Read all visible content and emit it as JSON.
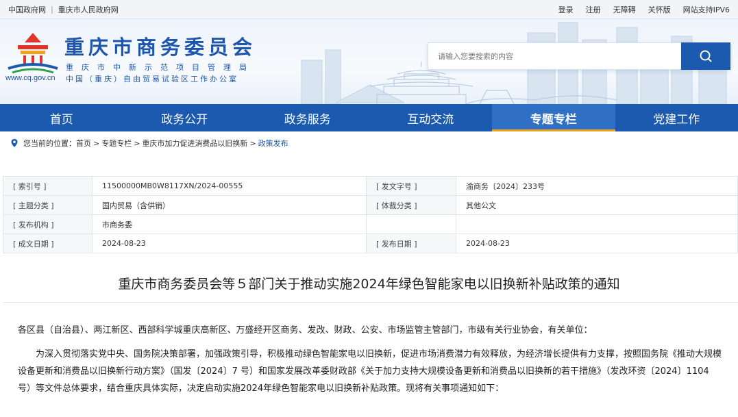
{
  "topbar": {
    "links_left": [
      "中国政府网",
      "重庆市人民政府网"
    ],
    "links_right": [
      "登录",
      "注册",
      "无障碍",
      "关怀版",
      "网站支持IPV6"
    ]
  },
  "header": {
    "title": "重庆市商务委员会",
    "subtitle1": "重庆市中新示范项目管理局",
    "subtitle2": "中国（重庆）自由贸易试验区工作办公室",
    "url": "www.cq.gov.cn",
    "search_placeholder": "请输入您要搜索的内容"
  },
  "nav": {
    "items": [
      "首页",
      "政务公开",
      "政务服务",
      "互动交流",
      "专题专栏",
      "党建工作"
    ],
    "active": "专题专栏"
  },
  "breadcrumb": {
    "prefix": "您当前的位置：",
    "items": [
      "首页",
      "专题专栏",
      "重庆市加力促进消费品以旧换新",
      "政策发布"
    ]
  },
  "meta": {
    "rows": [
      [
        "[ 索引号 ]",
        "11500000MB0W8117XN/2024-00555",
        "[ 发文字号 ]",
        "渝商务〔2024〕233号"
      ],
      [
        "[ 主题分类 ]",
        "国内贸易（含供销）",
        "[ 体裁分类 ]",
        "其他公文"
      ],
      [
        "[ 发布机构 ]",
        "市商务委",
        "",
        ""
      ],
      [
        "[ 成文日期 ]",
        "2024-08-23",
        "[ 发布日期 ]",
        "2024-08-23"
      ]
    ]
  },
  "article": {
    "title": "重庆市商务委员会等５部门关于推动实施2024年绿色智能家电以旧换新补贴政策的通知",
    "para1": "各区县（自治县）、两江新区、西部科学城重庆高新区、万盛经开区商务、发改、财政、公安、市场监管主管部门，市级有关行业协会，有关单位：",
    "para2": "为深入贯彻落实党中央、国务院决策部署，加强政策引导，积极推动绿色智能家电以旧换新，促进市场消费潜力有效释放，为经济增长提供有力支撑，按照国务院《推动大规模设备更新和消费品以旧换新行动方案》（国发〔2024〕7 号）和国家发展改革委财政部《关于加力支持大规模设备更新和消费品以旧换新的若干措施》（发改环资〔2024〕1104号）等文件总体要求，结合重庆具体实际，决定启动实施2024年绿色智能家电以旧换新补贴政策。现将有关事项通知如下："
  },
  "colors": {
    "brand": "#1b5aae",
    "accent": "#f2a11a"
  }
}
